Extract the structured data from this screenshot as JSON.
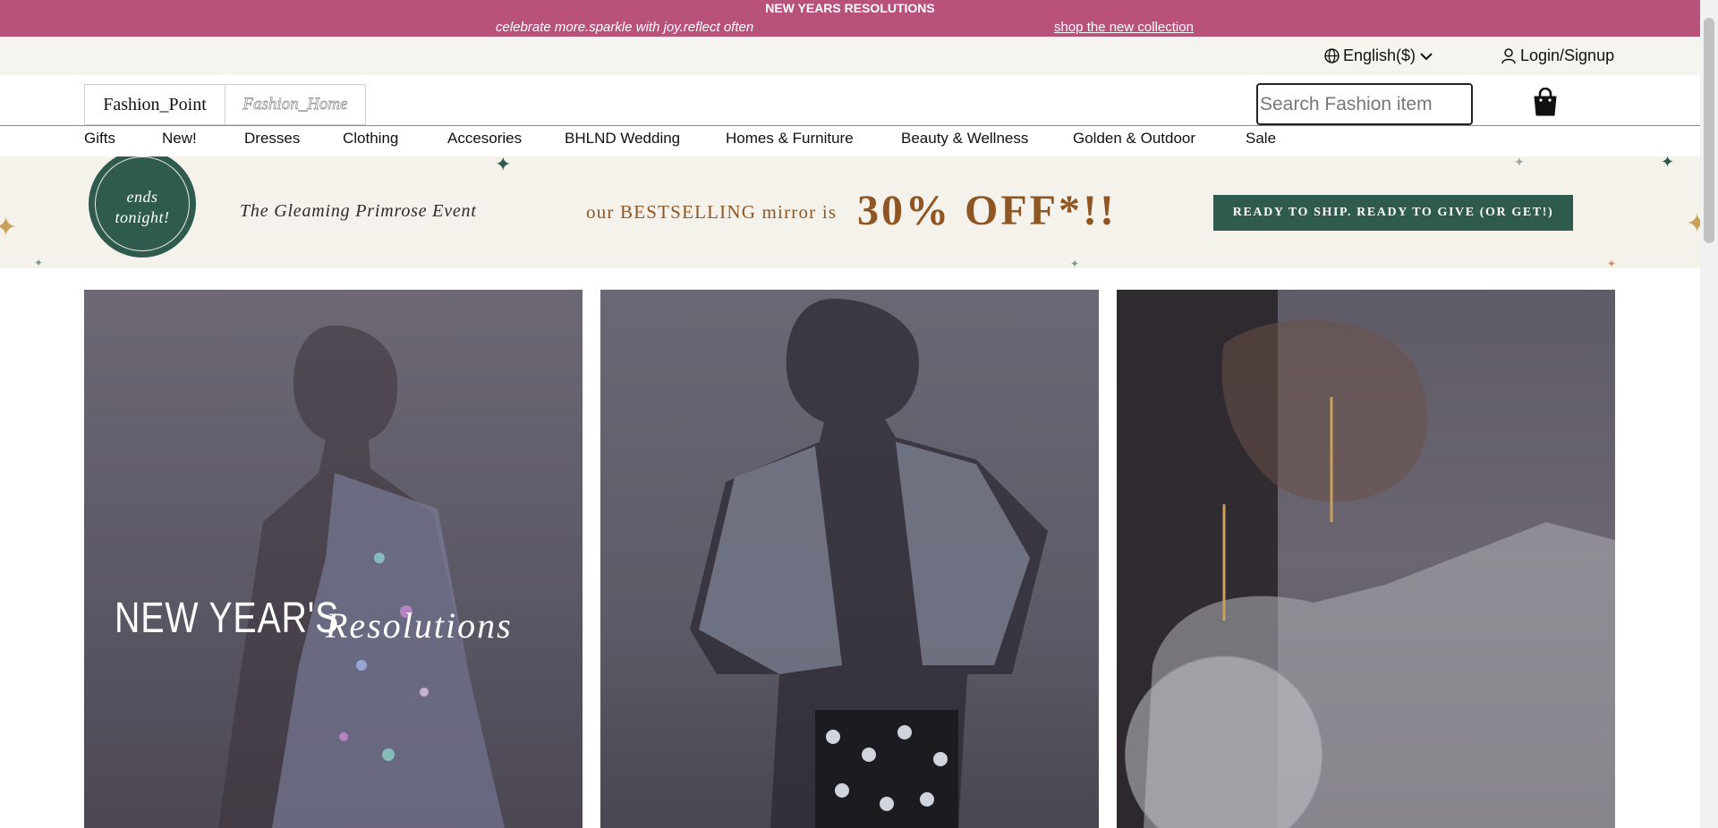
{
  "announcement": {
    "headline": "NEW YEARS RESOLUTIONS",
    "subtext": "celebrate more.sparkle with joy.reflect often",
    "link": "shop the new collection"
  },
  "utility": {
    "language": "English($)",
    "login": "Login/Signup"
  },
  "header": {
    "logo_primary": "Fashion_Point",
    "logo_secondary": "Fashion_Home",
    "search_placeholder": "Search Fashion item"
  },
  "nav": {
    "items": [
      "Gifts",
      "New!",
      "Dresses",
      "Clothing",
      "Accesories",
      "BHLND Wedding",
      "Homes & Furniture",
      "Beauty & Wellness",
      "Golden & Outdoor",
      "Sale"
    ]
  },
  "banner": {
    "badge": "ends\ntonight!",
    "event": "The Gleaming Primrose Event",
    "mirror": "our BESTSELLING mirror is",
    "discount": "30% OFF*!!",
    "cta": "READY TO SHIP. READY TO GIVE (OR GET!)"
  },
  "hero": {
    "overlay_title": "NEW YEAR'S",
    "overlay_script": "Resolutions"
  },
  "colors": {
    "announcement_bg": "#b9527a",
    "accent_green": "#2e5b4e",
    "promo_brown": "#8f5623",
    "banner_bg": "#f4f2ea"
  }
}
